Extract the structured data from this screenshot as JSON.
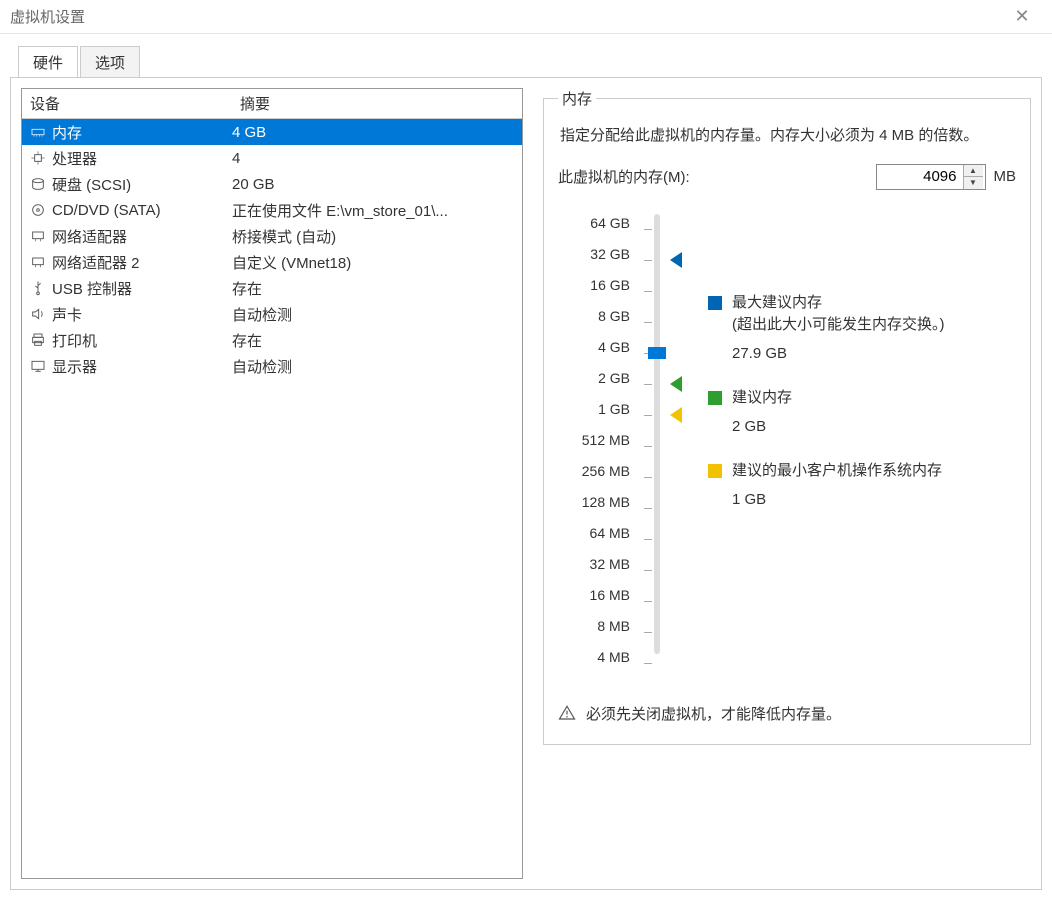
{
  "window": {
    "title": "虚拟机设置"
  },
  "tabs": {
    "hardware": "硬件",
    "options": "选项"
  },
  "table": {
    "header": {
      "device": "设备",
      "summary": "摘要"
    },
    "rows": [
      {
        "icon": "memory-icon",
        "device": "内存",
        "summary": "4 GB",
        "selected": true
      },
      {
        "icon": "cpu-icon",
        "device": "处理器",
        "summary": "4"
      },
      {
        "icon": "disk-icon",
        "device": "硬盘 (SCSI)",
        "summary": "20 GB"
      },
      {
        "icon": "cd-icon",
        "device": "CD/DVD (SATA)",
        "summary": "正在使用文件 E:\\vm_store_01\\..."
      },
      {
        "icon": "nic-icon",
        "device": "网络适配器",
        "summary": "桥接模式 (自动)"
      },
      {
        "icon": "nic-icon",
        "device": "网络适配器 2",
        "summary": "自定义 (VMnet18)"
      },
      {
        "icon": "usb-icon",
        "device": "USB 控制器",
        "summary": "存在"
      },
      {
        "icon": "sound-icon",
        "device": "声卡",
        "summary": "自动检测"
      },
      {
        "icon": "printer-icon",
        "device": "打印机",
        "summary": "存在"
      },
      {
        "icon": "display-icon",
        "device": "显示器",
        "summary": "自动检测"
      }
    ]
  },
  "memory": {
    "legend": "内存",
    "description": "指定分配给此虚拟机的内存量。内存大小必须为 4 MB 的倍数。",
    "field_label": "此虚拟机的内存(M):",
    "value": "4096",
    "unit": "MB",
    "scale": [
      "64 GB",
      "32 GB",
      "16 GB",
      "8 GB",
      "4 GB",
      "2 GB",
      "1 GB",
      "512 MB",
      "256 MB",
      "128 MB",
      "64 MB",
      "32 MB",
      "16 MB",
      "8 MB",
      "4 MB"
    ],
    "markers": {
      "max": {
        "scale_index_approx": 1,
        "color": "blue"
      },
      "thumb": {
        "scale_index_approx": 4,
        "color": "thumb"
      },
      "rec": {
        "scale_index_approx": 5,
        "color": "green"
      },
      "min": {
        "scale_index_approx": 6,
        "color": "yellow"
      }
    },
    "legend_items": {
      "max": {
        "title": "最大建议内存",
        "note": "(超出此大小可能发生内存交换。)",
        "value": "27.9 GB"
      },
      "rec": {
        "title": "建议内存",
        "value": "2 GB"
      },
      "min": {
        "title": "建议的最小客户机操作系统内存",
        "value": "1 GB"
      }
    },
    "warning": "必须先关闭虚拟机，才能降低内存量。"
  }
}
